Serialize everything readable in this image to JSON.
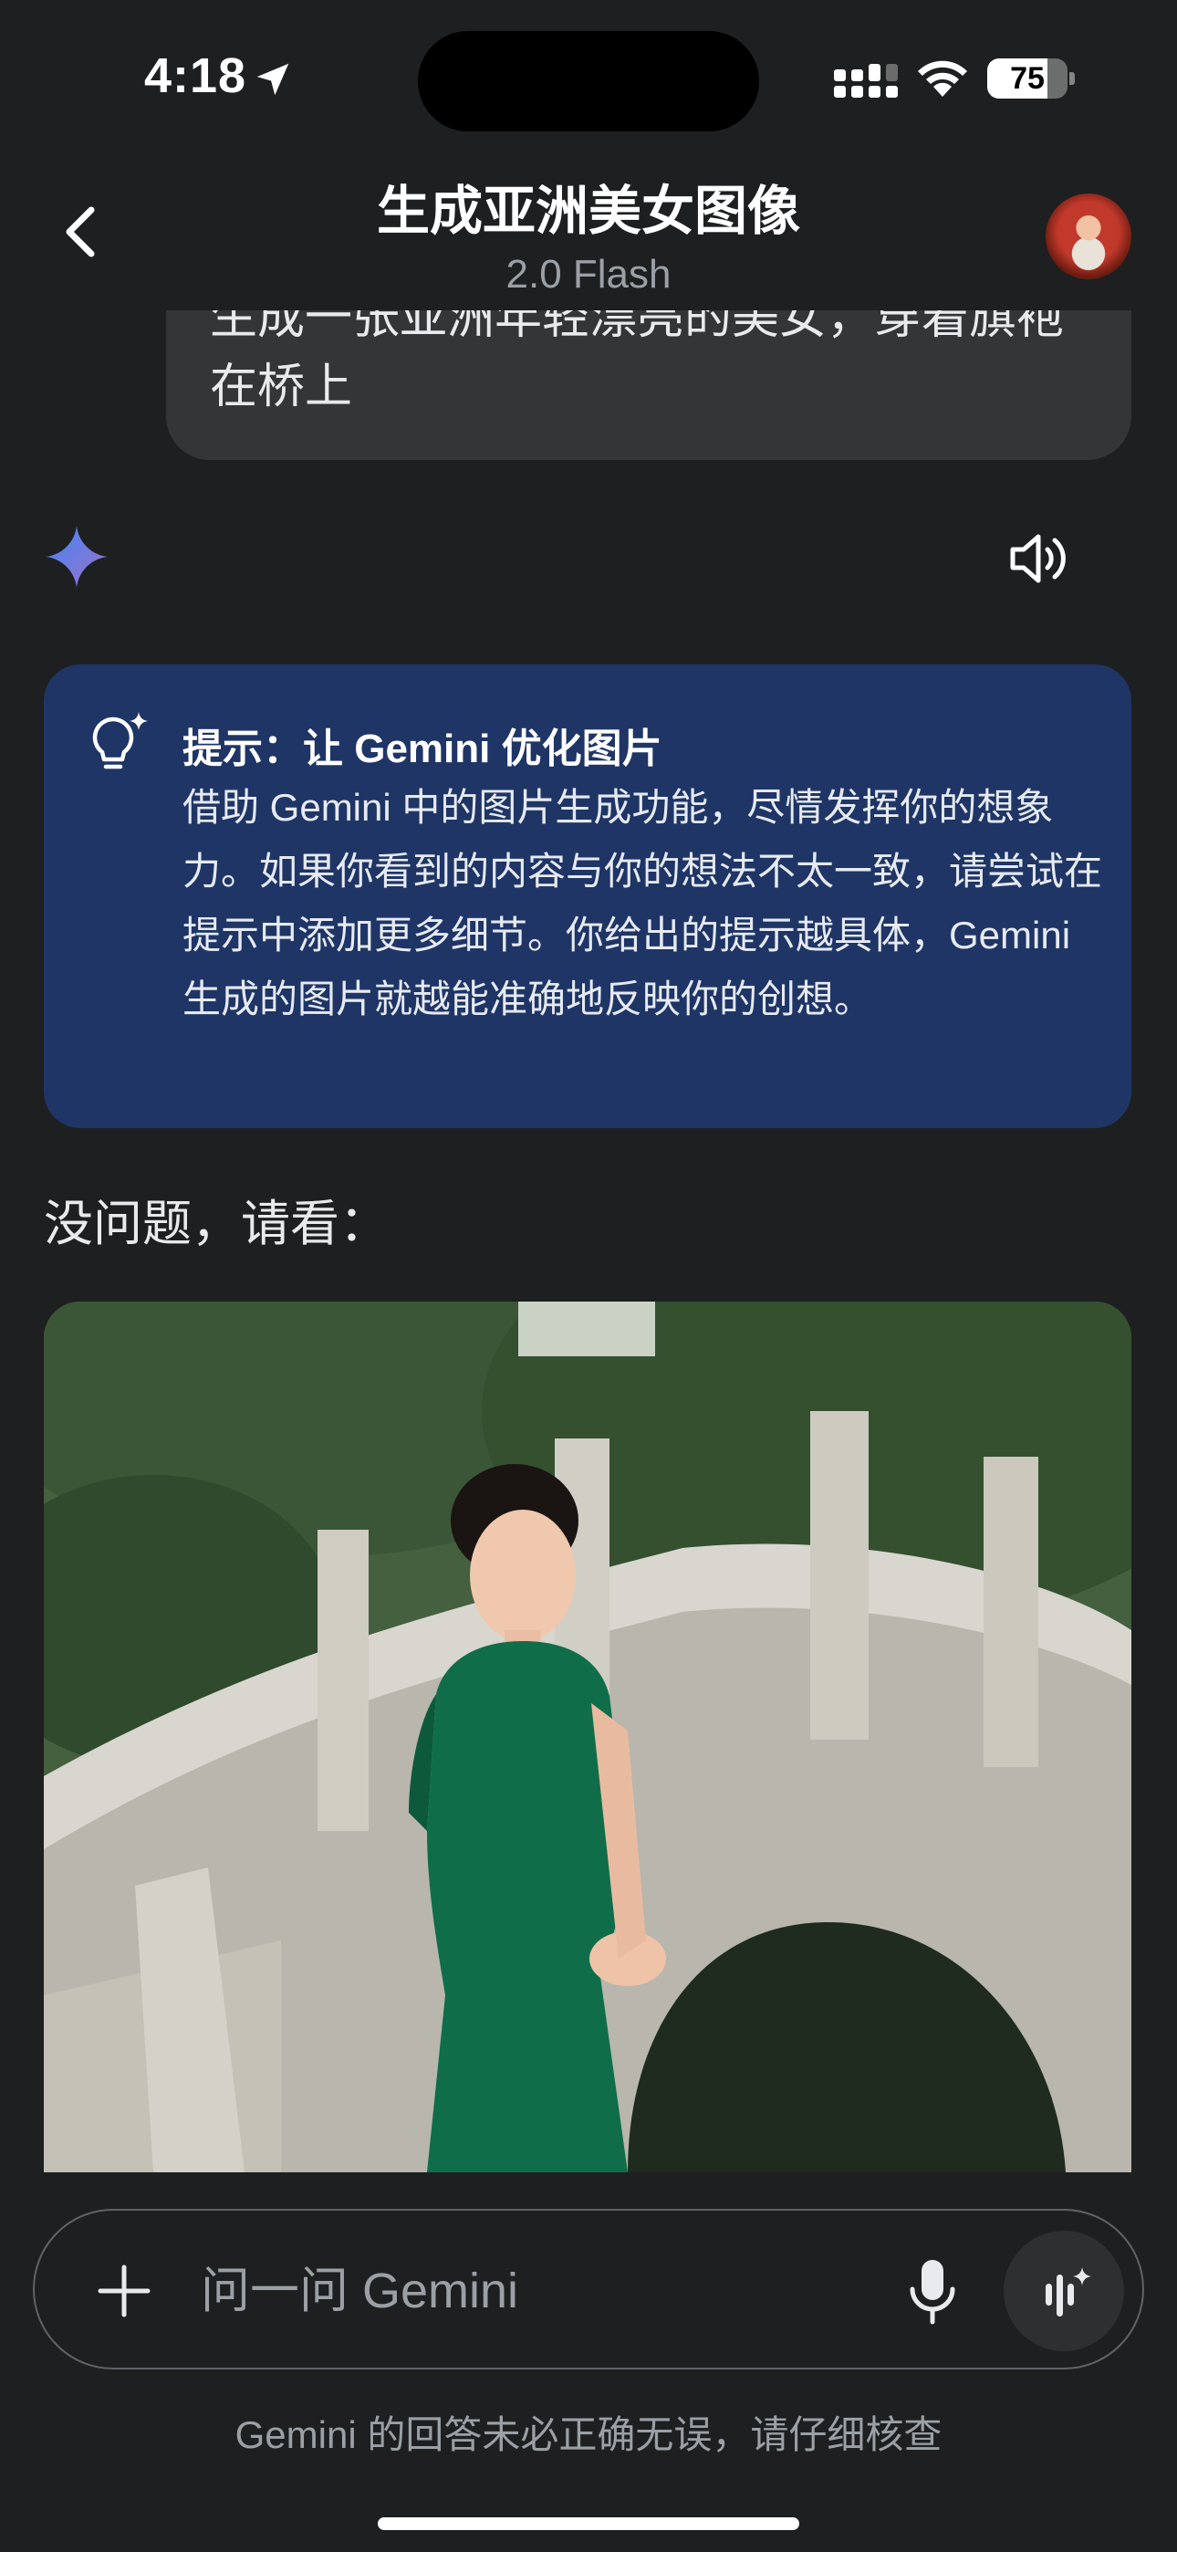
{
  "status_bar": {
    "time": "4:18",
    "battery": "75",
    "battery_level": 0.75
  },
  "header": {
    "title": "生成亚洲美女图像",
    "subtitle": "2.0 Flash"
  },
  "conversation": {
    "user_message": "生成一张亚洲年轻漂亮的美女，穿着旗袍在桥上",
    "tip": {
      "title": "提示：让 Gemini 优化图片",
      "body": "借助 Gemini 中的图片生成功能，尽情发挥你的想象力。如果你看到的内容与你的想法不太一致，请尝试在提示中添加更多细节。你给出的提示越具体，Gemini 生成的图片就越能准确地反映你的创想。"
    },
    "reply": "没问题，请看："
  },
  "composer": {
    "placeholder": "问一问 Gemini"
  },
  "disclaimer": "Gemini 的回答未必正确无误，请仔细核查",
  "colors": {
    "background": "#1e1f20",
    "user_bubble": "#333537",
    "tip_card": "#1f3566",
    "gemini_spark_start": "#4285f4",
    "gemini_spark_end": "#9b72cb",
    "qipao_green": "#0f6e49"
  },
  "icons": {
    "back": "chevron-left-icon",
    "spark": "gemini-spark-icon",
    "speaker": "speaker-icon",
    "tip": "lightbulb-sparkle-icon",
    "plus": "plus-icon",
    "mic": "microphone-icon",
    "live": "gemini-live-icon"
  }
}
